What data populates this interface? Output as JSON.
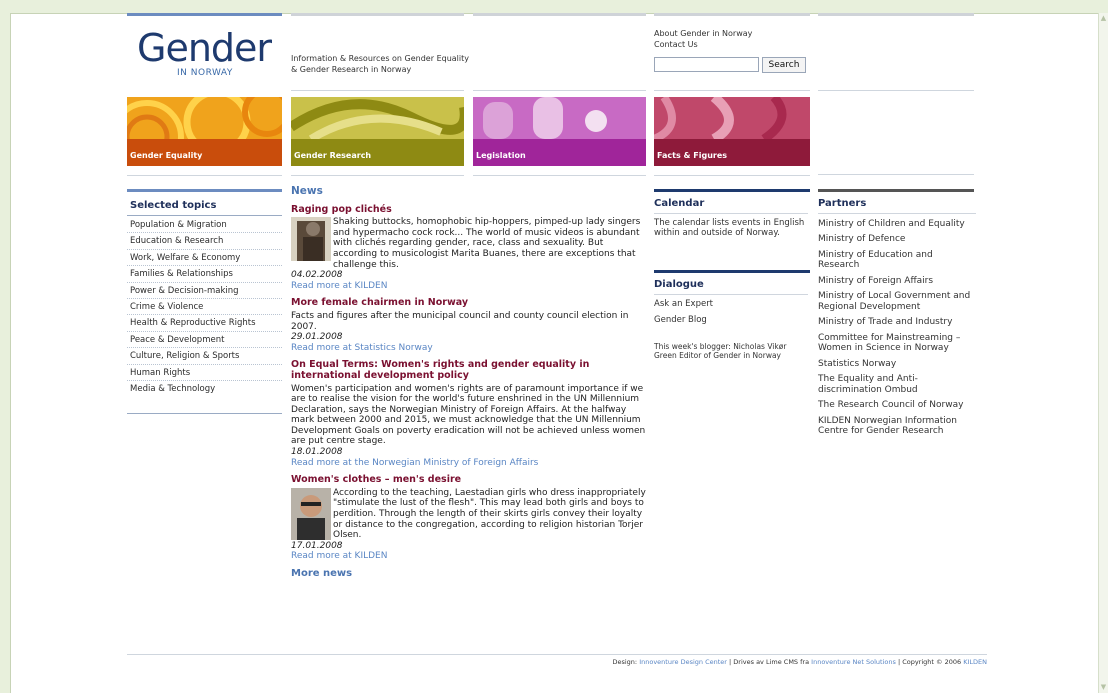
{
  "header": {
    "logo_word": "Gender",
    "logo_sub": "IN NORWAY",
    "tagline": "Information & Resources on Gender Equality & Gender Research in Norway",
    "links": [
      "About Gender in Norway",
      "Contact Us"
    ],
    "search_value": "",
    "search_button": "Search"
  },
  "tiles": [
    {
      "label": "Gender Equality",
      "color": "#c94d0c"
    },
    {
      "label": "Gender Research",
      "color": "#8e8a13"
    },
    {
      "label": "Legislation",
      "color": "#a0259a"
    },
    {
      "label": "Facts & Figures",
      "color": "#8e1a3a"
    }
  ],
  "sidebar": {
    "title": "Selected topics",
    "items": [
      "Population & Migration",
      "Education & Research",
      "Work, Welfare & Economy",
      "Families & Relationships",
      "Power & Decision-making",
      "Crime & Violence",
      "Health & Reproductive Rights",
      "Peace & Development",
      "Culture, Religion & Sports",
      "Human Rights",
      "Media & Technology"
    ]
  },
  "news": {
    "title": "News",
    "articles": [
      {
        "headline": "Raging pop clichés",
        "body": "Shaking buttocks, homophobic hip-hoppers, pimped-up lady singers and hypermacho cock rock... The world of music videos is abundant with clichés regarding gender, race, class and sexuality. But according to musicologist Marita Buanes, there are exceptions that challenge this.",
        "date": "04.02.2008",
        "link": "Read more at KILDEN"
      },
      {
        "headline": "More female chairmen in Norway",
        "body": "Facts and figures after the municipal council and county council election in 2007.",
        "date": "29.01.2008",
        "link": "Read more at Statistics Norway"
      },
      {
        "headline": "On Equal Terms: Women's rights and gender equality in international development policy",
        "body": "Women's participation and women's rights are of paramount importance if we are to realise the vision for the world's future enshrined in the UN Millennium Declaration, says the Norwegian Ministry of Foreign Affairs. At the halfway mark between 2000 and 2015, we must acknowledge that the UN Millennium Development Goals on poverty eradication will not be achieved unless women are put centre stage.",
        "date": "18.01.2008",
        "link": "Read more at the Norwegian Ministry of Foreign Affairs"
      },
      {
        "headline": "Women's clothes – men's desire",
        "body": "According to the teaching, Laestadian girls who dress inappropriately \"stimulate the lust of the flesh\". This may lead both girls and boys to perdition. Through the length of their skirts girls convey their loyalty or distance to the congregation, according to religion historian Torjer Olsen.",
        "date": "17.01.2008",
        "link": "Read more at KILDEN"
      }
    ],
    "more": "More news"
  },
  "calendar": {
    "title": "Calendar",
    "text": "The calendar lists events in English within and outside of Norway."
  },
  "dialogue": {
    "title": "Dialogue",
    "links": [
      "Ask an Expert",
      "Gender Blog"
    ],
    "blogger": "This week's blogger: Nicholas Vikør Green Editor of Gender in Norway"
  },
  "partners": {
    "title": "Partners",
    "items": [
      "Ministry of Children and Equality",
      "Ministry of Defence",
      "Ministry of Education and Research",
      "Ministry of Foreign Affairs",
      "Ministry of Local Government and Regional Development",
      "Ministry of Trade and Industry",
      "Committee for Mainstreaming – Women in Science in Norway",
      "Statistics Norway",
      "The Equality and Anti-discrimination Ombud",
      "The Research Council of Norway",
      "KILDEN Norwegian Information Centre for Gender Research"
    ]
  },
  "footer": {
    "design_label": "Design:",
    "design_link": "Innoventure Design Center",
    "drives": "| Drives av Lime CMS fra",
    "cms_link": "Innoventure Net Solutions",
    "copyright": "| Copyright © 2006",
    "kilden": "KILDEN"
  }
}
